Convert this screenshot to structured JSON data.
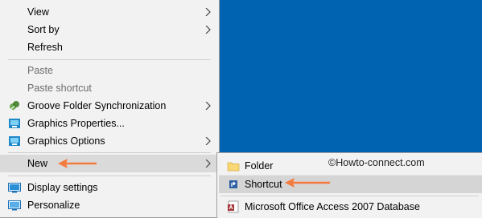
{
  "main_menu": {
    "items": [
      {
        "label": "View"
      },
      {
        "label": "Sort by"
      },
      {
        "label": "Refresh"
      },
      {
        "label": "Paste"
      },
      {
        "label": "Paste shortcut"
      },
      {
        "label": "Groove Folder Synchronization"
      },
      {
        "label": "Graphics Properties..."
      },
      {
        "label": "Graphics Options"
      },
      {
        "label": "New"
      },
      {
        "label": "Display settings"
      },
      {
        "label": "Personalize"
      }
    ]
  },
  "sub_menu": {
    "items": [
      {
        "label": "Folder"
      },
      {
        "label": "Shortcut"
      },
      {
        "label": "Microsoft Office Access 2007 Database"
      }
    ]
  },
  "watermark": "©Howto-connect.com",
  "colors": {
    "desktop": "#0063b1",
    "arrow": "#f47b3e",
    "menu": "#f2f2f2"
  }
}
